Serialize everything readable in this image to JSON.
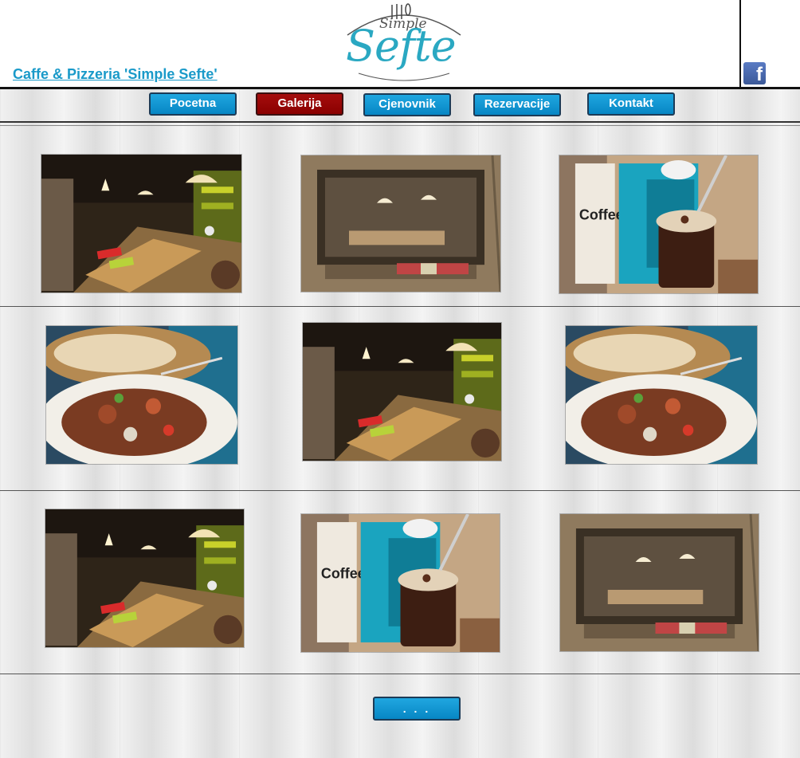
{
  "header": {
    "site_title": "Caffe & Pizzeria 'Simple Sefte'",
    "logo_script": "Simple",
    "logo_main": "Sefte",
    "facebook_icon": "facebook-icon"
  },
  "nav": {
    "items": [
      "Pocetna",
      "Galerija",
      "Cjenovnik",
      "Rezervacije",
      "Kontakt"
    ],
    "active_index": 1,
    "active_color": "#9b0a0a",
    "button_color": "#1496d4"
  },
  "gallery": {
    "photos": [
      {
        "subject": "restaurant-interior"
      },
      {
        "subject": "window-view"
      },
      {
        "subject": "coffee-and-menu"
      },
      {
        "subject": "salad-dish"
      },
      {
        "subject": "restaurant-interior"
      },
      {
        "subject": "salad-dish"
      },
      {
        "subject": "restaurant-interior"
      },
      {
        "subject": "coffee-and-menu"
      },
      {
        "subject": "window-view"
      }
    ]
  },
  "more_button": ". . ."
}
